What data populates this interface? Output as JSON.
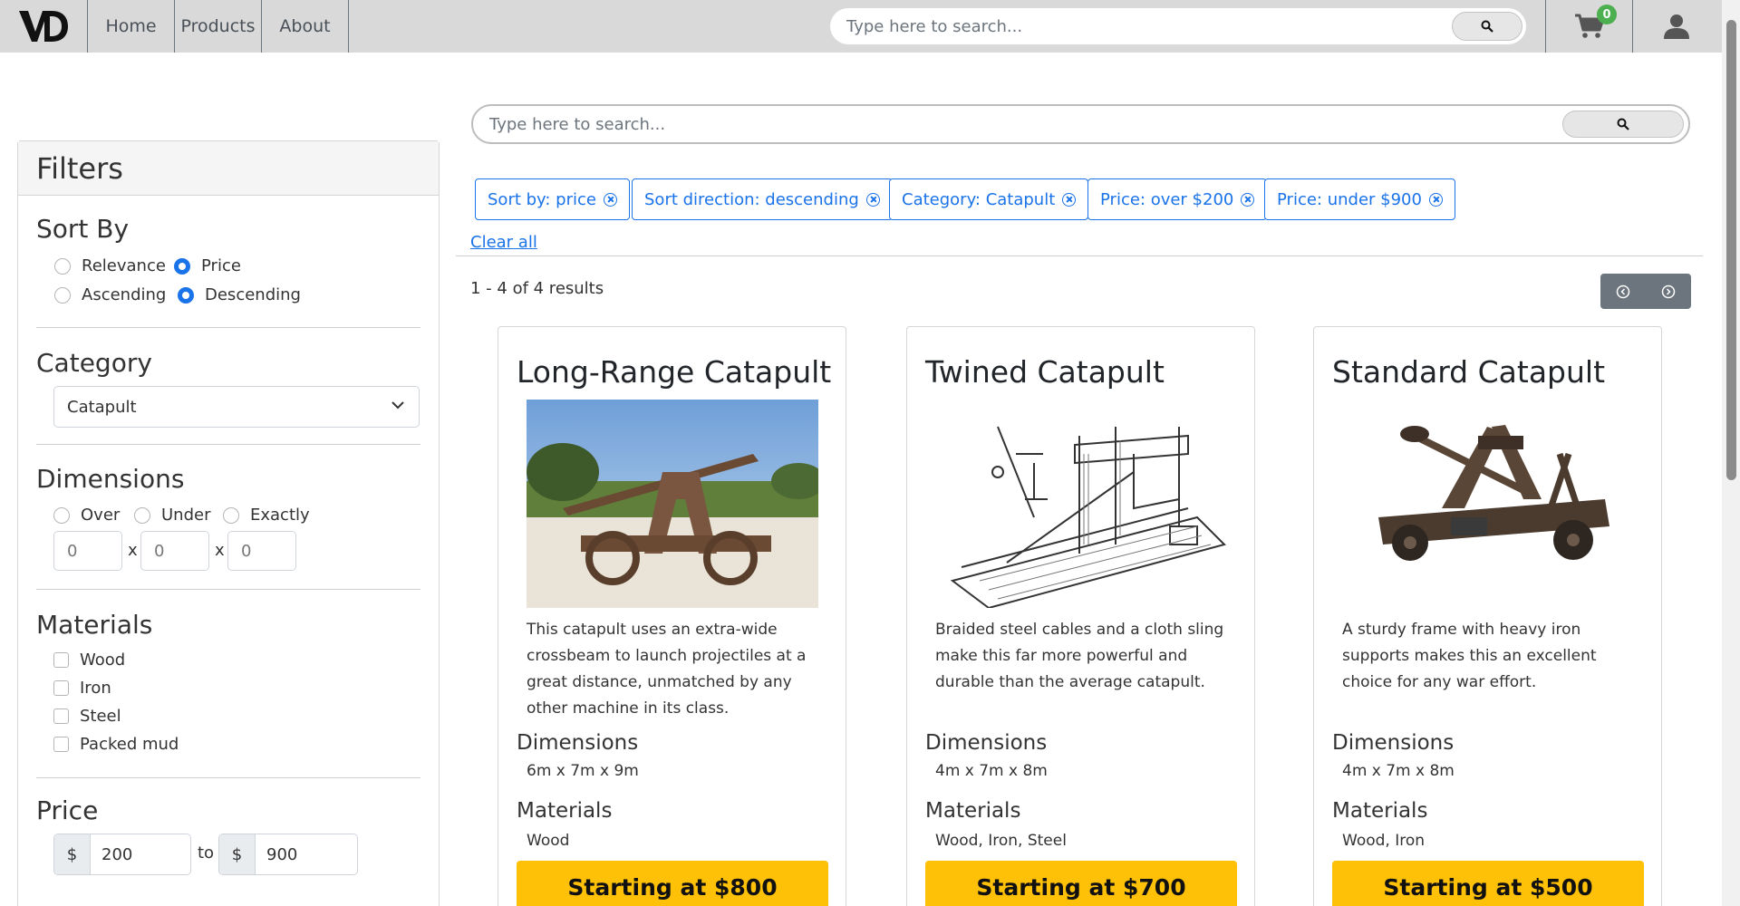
{
  "nav": {
    "logo_text": "VD",
    "items": [
      "Home",
      "Products",
      "About"
    ],
    "search_placeholder": "Type here to search...",
    "cart_count": "0"
  },
  "filters": {
    "title": "Filters",
    "sort": {
      "heading": "Sort By",
      "options": [
        "Relevance",
        "Price"
      ],
      "selected_option": "Price",
      "directions": [
        "Ascending",
        "Descending"
      ],
      "selected_direction": "Descending"
    },
    "category": {
      "heading": "Category",
      "selected": "Catapult"
    },
    "dimensions": {
      "heading": "Dimensions",
      "modes": [
        "Over",
        "Under",
        "Exactly"
      ],
      "values": [
        "0",
        "0",
        "0"
      ],
      "separator": "x"
    },
    "materials": {
      "heading": "Materials",
      "options": [
        "Wood",
        "Iron",
        "Steel",
        "Packed mud"
      ]
    },
    "price": {
      "heading": "Price",
      "currency": "$",
      "min": "200",
      "max": "900",
      "to_label": "to"
    }
  },
  "main": {
    "search_placeholder": "Type here to search...",
    "chips": [
      "Sort by: price",
      "Sort direction: descending",
      "Category: Catapult",
      "Price: over $200",
      "Price: under $900"
    ],
    "clear_all": "Clear all",
    "results_text": "1 - 4 of 4 results"
  },
  "products": [
    {
      "name": "Long-Range Catapult",
      "description": "This catapult uses an extra-wide crossbeam to launch projectiles at a great distance, unmatched by any other machine in its class.",
      "dimensions_label": "Dimensions",
      "dimensions": "6m x 7m x 9m",
      "materials_label": "Materials",
      "materials": "Wood",
      "price_label": "Starting at $800"
    },
    {
      "name": "Twined Catapult",
      "description": "Braided steel cables and a cloth sling make this far more powerful and durable than the average catapult.",
      "dimensions_label": "Dimensions",
      "dimensions": "4m x 7m x 8m",
      "materials_label": "Materials",
      "materials": "Wood, Iron, Steel",
      "price_label": "Starting at $700"
    },
    {
      "name": "Standard Catapult",
      "description": "A sturdy frame with heavy iron supports makes this an excellent choice for any war effort.",
      "dimensions_label": "Dimensions",
      "dimensions": "4m x 7m x 8m",
      "materials_label": "Materials",
      "materials": "Wood, Iron",
      "price_label": "Starting at $500"
    }
  ],
  "colors": {
    "accent": "#1a73e8",
    "buy_button": "#ffc107",
    "topbar": "#d9d9d9",
    "cart_badge": "#4caf50"
  },
  "icons": [
    "search-icon",
    "cart-icon",
    "user-icon",
    "chevron-down-icon",
    "chevron-left-icon",
    "chevron-right-icon",
    "remove-chip-icon"
  ]
}
